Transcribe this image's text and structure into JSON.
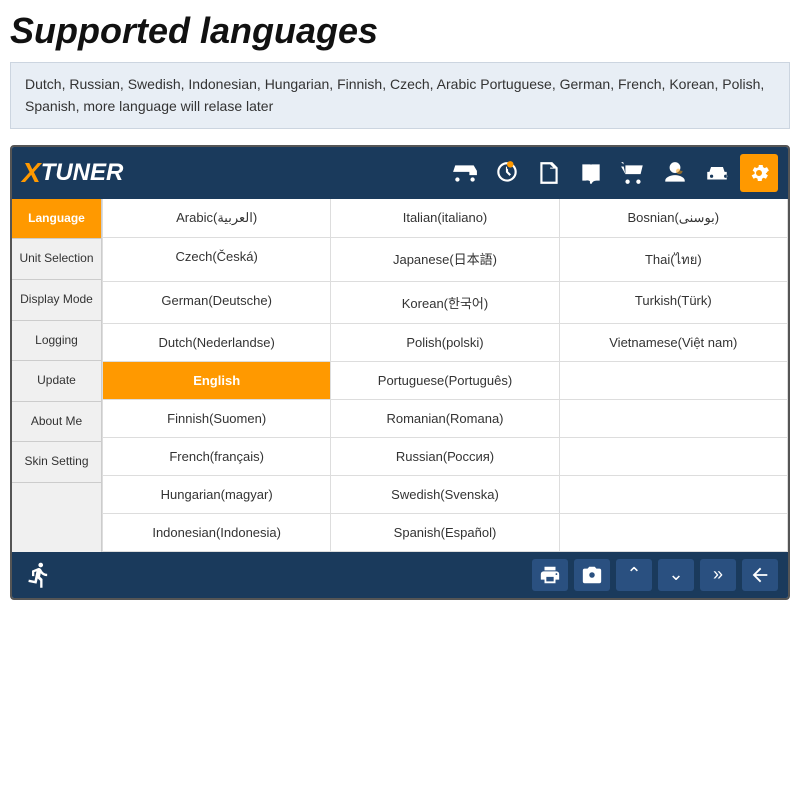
{
  "page": {
    "title": "Supported languages",
    "subtitle": "Dutch, Russian, Swedish, Indonesian, Hungarian, Finnish, Czech, Arabic Portuguese, German, French, Korean, Polish, Spanish, more language will relase later"
  },
  "header": {
    "logo_x": "X",
    "logo_tuner": "TUNER"
  },
  "sidebar": {
    "items": [
      {
        "id": "language",
        "label": "Language",
        "active": true
      },
      {
        "id": "unit-selection",
        "label": "Unit Selection",
        "active": false
      },
      {
        "id": "display-mode",
        "label": "Display Mode",
        "active": false
      },
      {
        "id": "logging",
        "label": "Logging",
        "active": false
      },
      {
        "id": "update",
        "label": "Update",
        "active": false
      },
      {
        "id": "about-me",
        "label": "About Me",
        "active": false
      },
      {
        "id": "skin-setting",
        "label": "Skin Setting",
        "active": false
      }
    ]
  },
  "languages": {
    "col1": [
      "Arabic(العربية)",
      "Czech(Česká)",
      "German(Deutsche)",
      "Dutch(Nederlandse)",
      "English",
      "Finnish(Suomen)",
      "French(français)",
      "Hungarian(magyar)",
      "Indonesian(Indonesia)"
    ],
    "col2": [
      "Italian(italiano)",
      "Japanese(日本語)",
      "Korean(한국어)",
      "Polish(polski)",
      "Portuguese(Português)",
      "Romanian(Romana)",
      "Russian(Россия)",
      "Swedish(Svenska)",
      "Spanish(Español)"
    ],
    "col3": [
      "Bosnian(بوسنی)",
      "Thai(ไทย)",
      "Turkish(Türk)",
      "Vietnamese(Việt nam)",
      "",
      "",
      "",
      "",
      ""
    ]
  }
}
